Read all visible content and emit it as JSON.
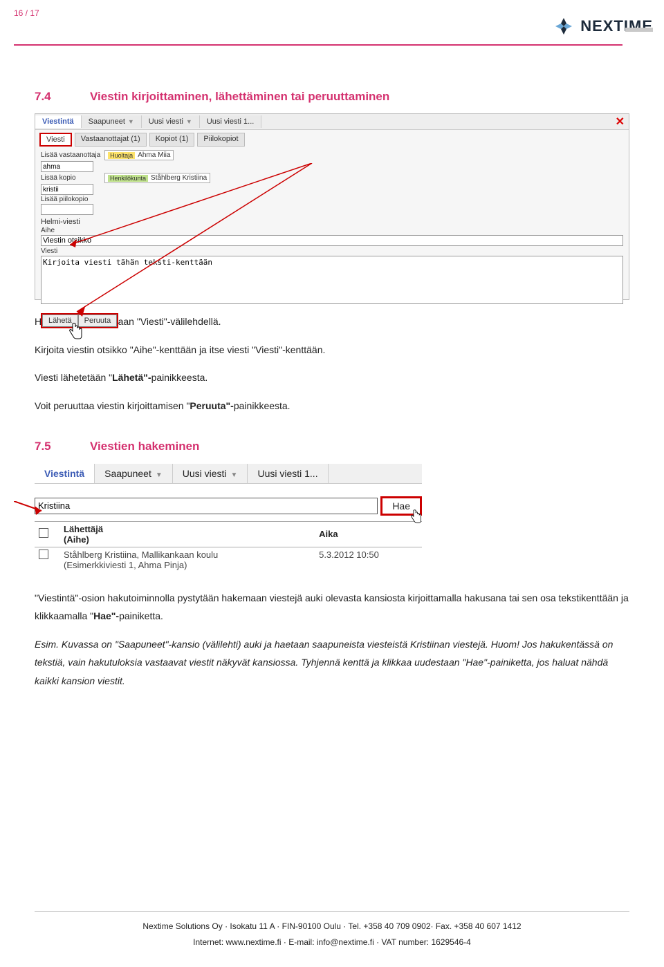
{
  "page_number": "16 / 17",
  "brand": "NEXTIME",
  "section1": {
    "num": "7.4",
    "title": "Viestin kirjoittaminen, lähettäminen tai peruuttaminen",
    "p1": "Helmi-viesti kirjoitetaan \"Viesti\"-välilehdellä.",
    "p2": "Kirjoita viestin otsikko \"Aihe\"-kenttään ja itse viesti \"Viesti\"-kenttään.",
    "p3a": "Viesti lähetetään \"",
    "p3b": "Lähetä\"-",
    "p3c": "painikkeesta.",
    "p4a": "Voit peruuttaa viestin kirjoittamisen \"",
    "p4b": "Peruuta\"-",
    "p4c": "painikkeesta."
  },
  "shot1": {
    "tab_main": "Viestintä",
    "tab_saapuneet": "Saapuneet",
    "tab_uusi": "Uusi viesti",
    "tab_uusi1": "Uusi viesti 1...",
    "sub_viesti": "Viesti",
    "sub_vast": "Vastaanottajat (1)",
    "sub_kop": "Kopiot (1)",
    "sub_piilo": "Piilokopiot",
    "lbl_add_rcpt": "Lisää vastaanottaja",
    "val_add_rcpt": "ahma",
    "badge_huoltaja": "Huoltaja",
    "badge_huoltaja_name": "Ahma Miia",
    "lbl_add_copy": "Lisää kopio",
    "val_add_copy": "kristii",
    "badge_henk": "Henkilökunta",
    "badge_henk_name": "Ståhlberg Kristiina",
    "lbl_add_bcc": "Lisää piilokopio",
    "lbl_helmi": "Helmi-viesti",
    "lbl_aihe": "Aihe",
    "val_aihe": "Viestin otsikko",
    "lbl_viesti": "Viesti",
    "val_viesti": "Kirjoita viesti tähän teksti-kenttään",
    "btn_laheta": "Lähetä",
    "btn_peruuta": "Peruuta"
  },
  "section2": {
    "num": "7.5",
    "title": "Viestien hakeminen",
    "p1": "\"Viestintä\"-osion hakutoiminnolla pystytään hakemaan viestejä auki olevasta kansiosta kirjoittamalla hakusana tai sen osa tekstikenttään ja klikkaamalla \"",
    "p1b": "Hae\"-",
    "p1c": "painiketta.",
    "p2": "Esim. Kuvassa on \"Saapuneet\"-kansio (välilehti) auki ja haetaan saapuneista viesteistä Kristiinan viestejä. Huom! Jos hakukentässä on tekstiä, vain hakutuloksia vastaavat viestit näkyvät kansiossa. Tyhjennä kenttä ja klikkaa uudestaan \"Hae\"-painiketta, jos haluat nähdä kaikki kansion viestit."
  },
  "shot2": {
    "tab_main": "Viestintä",
    "tab_saapuneet": "Saapuneet",
    "tab_uusi": "Uusi viesti",
    "tab_uusi1": "Uusi viesti 1...",
    "search_val": "Kristiina",
    "btn_hae": "Hae",
    "th_lahettaja": "Lähettäjä",
    "th_aihe": "(Aihe)",
    "th_aika": "Aika",
    "row_sender": "Ståhlberg Kristiina, Mallikankaan koulu",
    "row_subject": "(Esimerkkiviesti 1, Ahma Pinja)",
    "row_time": "5.3.2012 10:50"
  },
  "footer": {
    "l1": "Nextime Solutions Oy · Isokatu 11 A · FIN-90100 Oulu · Tel. +358 40 709 0902· Fax. +358 40 607 1412",
    "l2": "Internet: www.nextime.fi · E-mail: info@nextime.fi · VAT number: 1629546-4"
  }
}
